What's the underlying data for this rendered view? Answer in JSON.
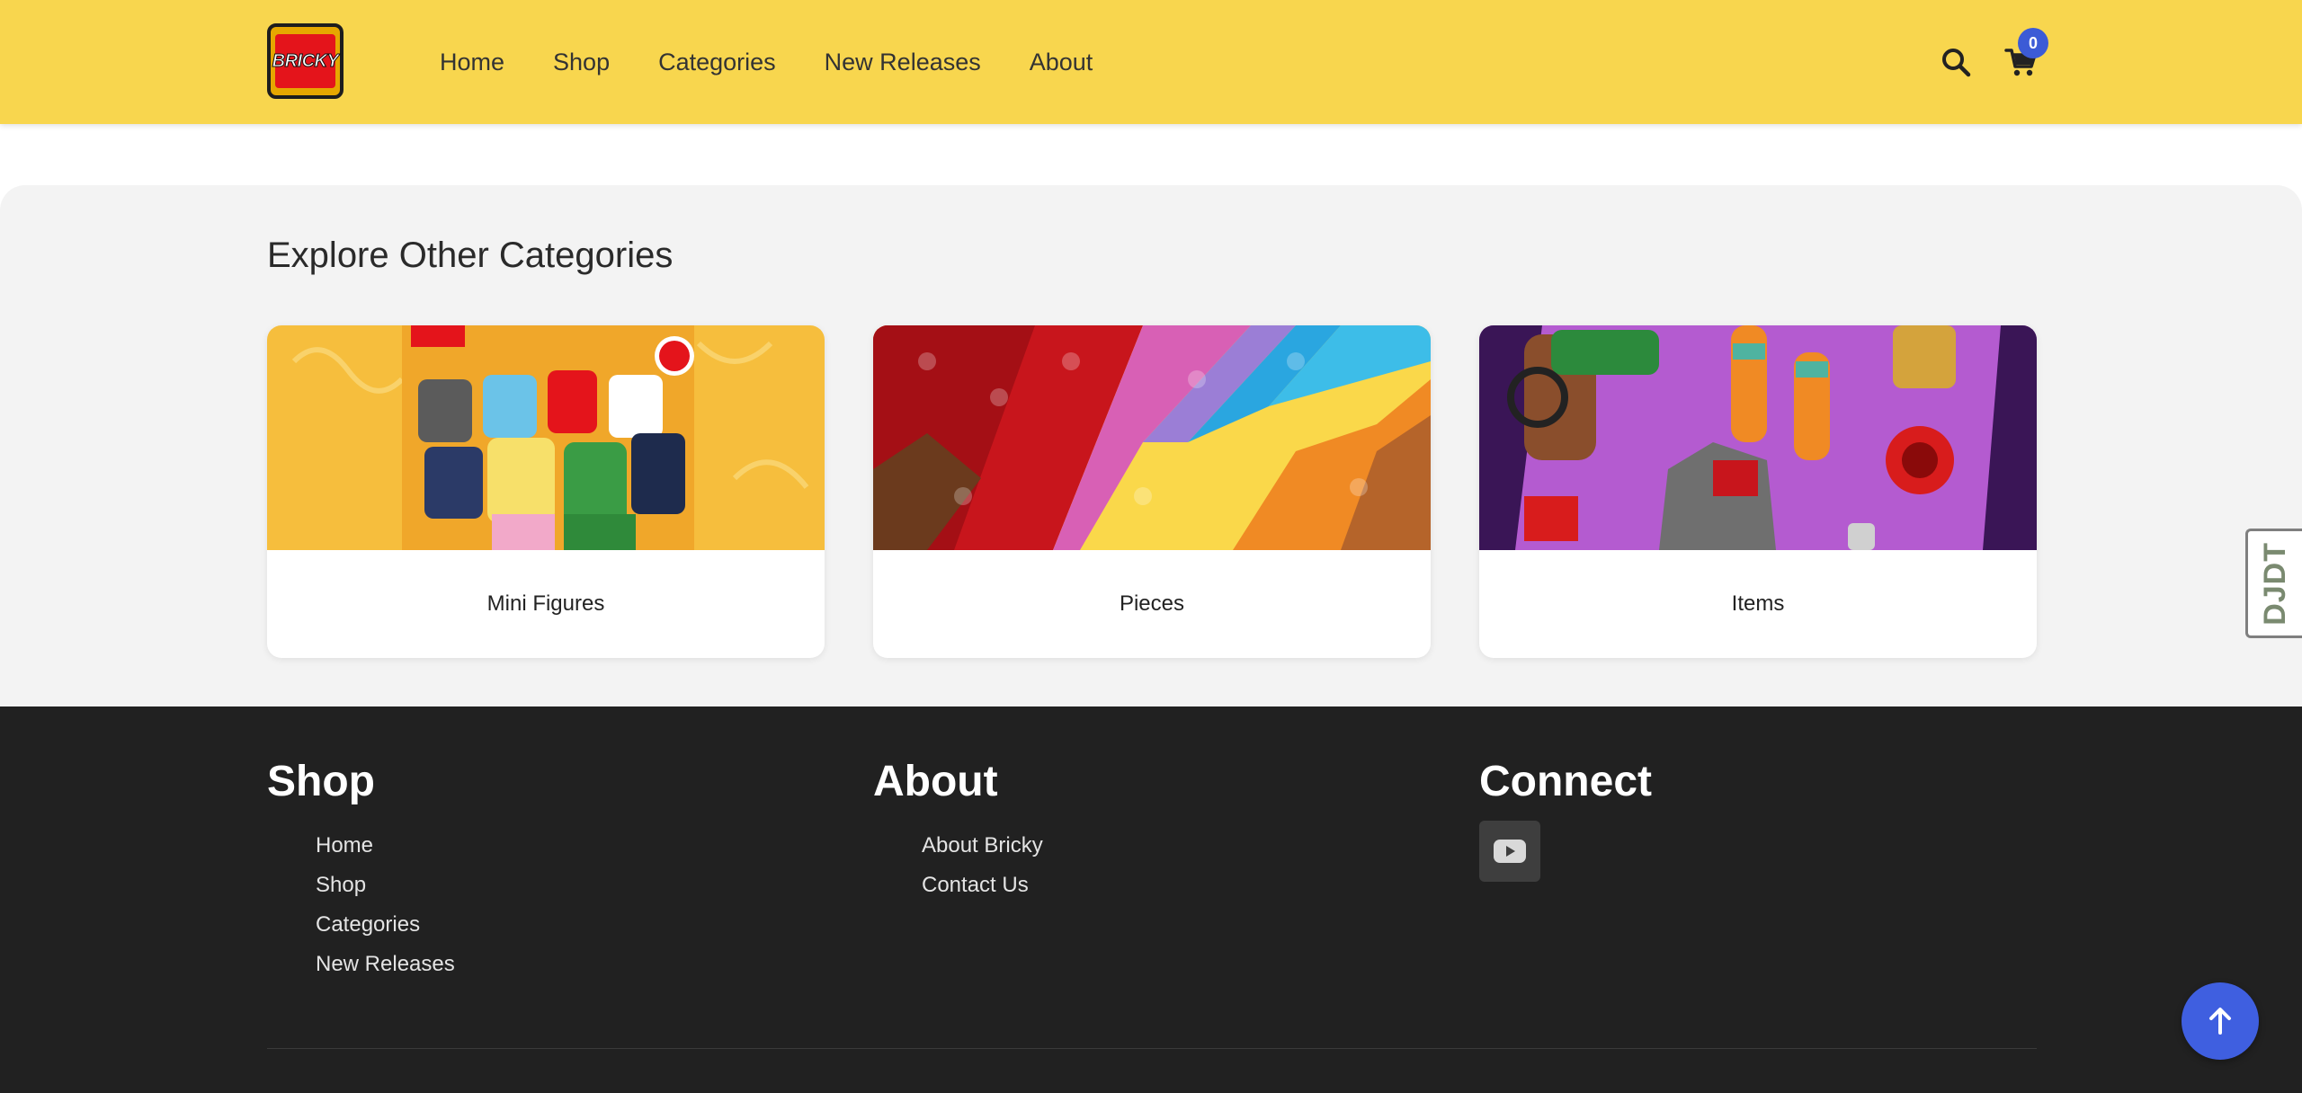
{
  "header": {
    "logo_text": "BRICKY",
    "nav": [
      "Home",
      "Shop",
      "Categories",
      "New Releases",
      "About"
    ],
    "cart_count": "0",
    "icons": {
      "search": "search-icon",
      "cart": "cart-icon"
    },
    "colors": {
      "background": "#f8d64e",
      "badge": "#3c5bd6"
    }
  },
  "categories": {
    "title": "Explore Other Categories",
    "cards": [
      {
        "label": "Mini Figures",
        "image": "minifigures-image"
      },
      {
        "label": "Pieces",
        "image": "pieces-image"
      },
      {
        "label": "Items",
        "image": "items-image"
      }
    ]
  },
  "side_tab": {
    "label": "DJDT"
  },
  "footer": {
    "shop": {
      "heading": "Shop",
      "links": [
        "Home",
        "Shop",
        "Categories",
        "New Releases"
      ]
    },
    "about": {
      "heading": "About",
      "links": [
        "About Bricky",
        "Contact Us"
      ]
    },
    "connect": {
      "heading": "Connect",
      "icon": "youtube-icon"
    },
    "colors": {
      "background": "#212121"
    }
  },
  "scroll_top": {
    "icon": "arrow-up-icon",
    "color": "#3f5fe0"
  }
}
